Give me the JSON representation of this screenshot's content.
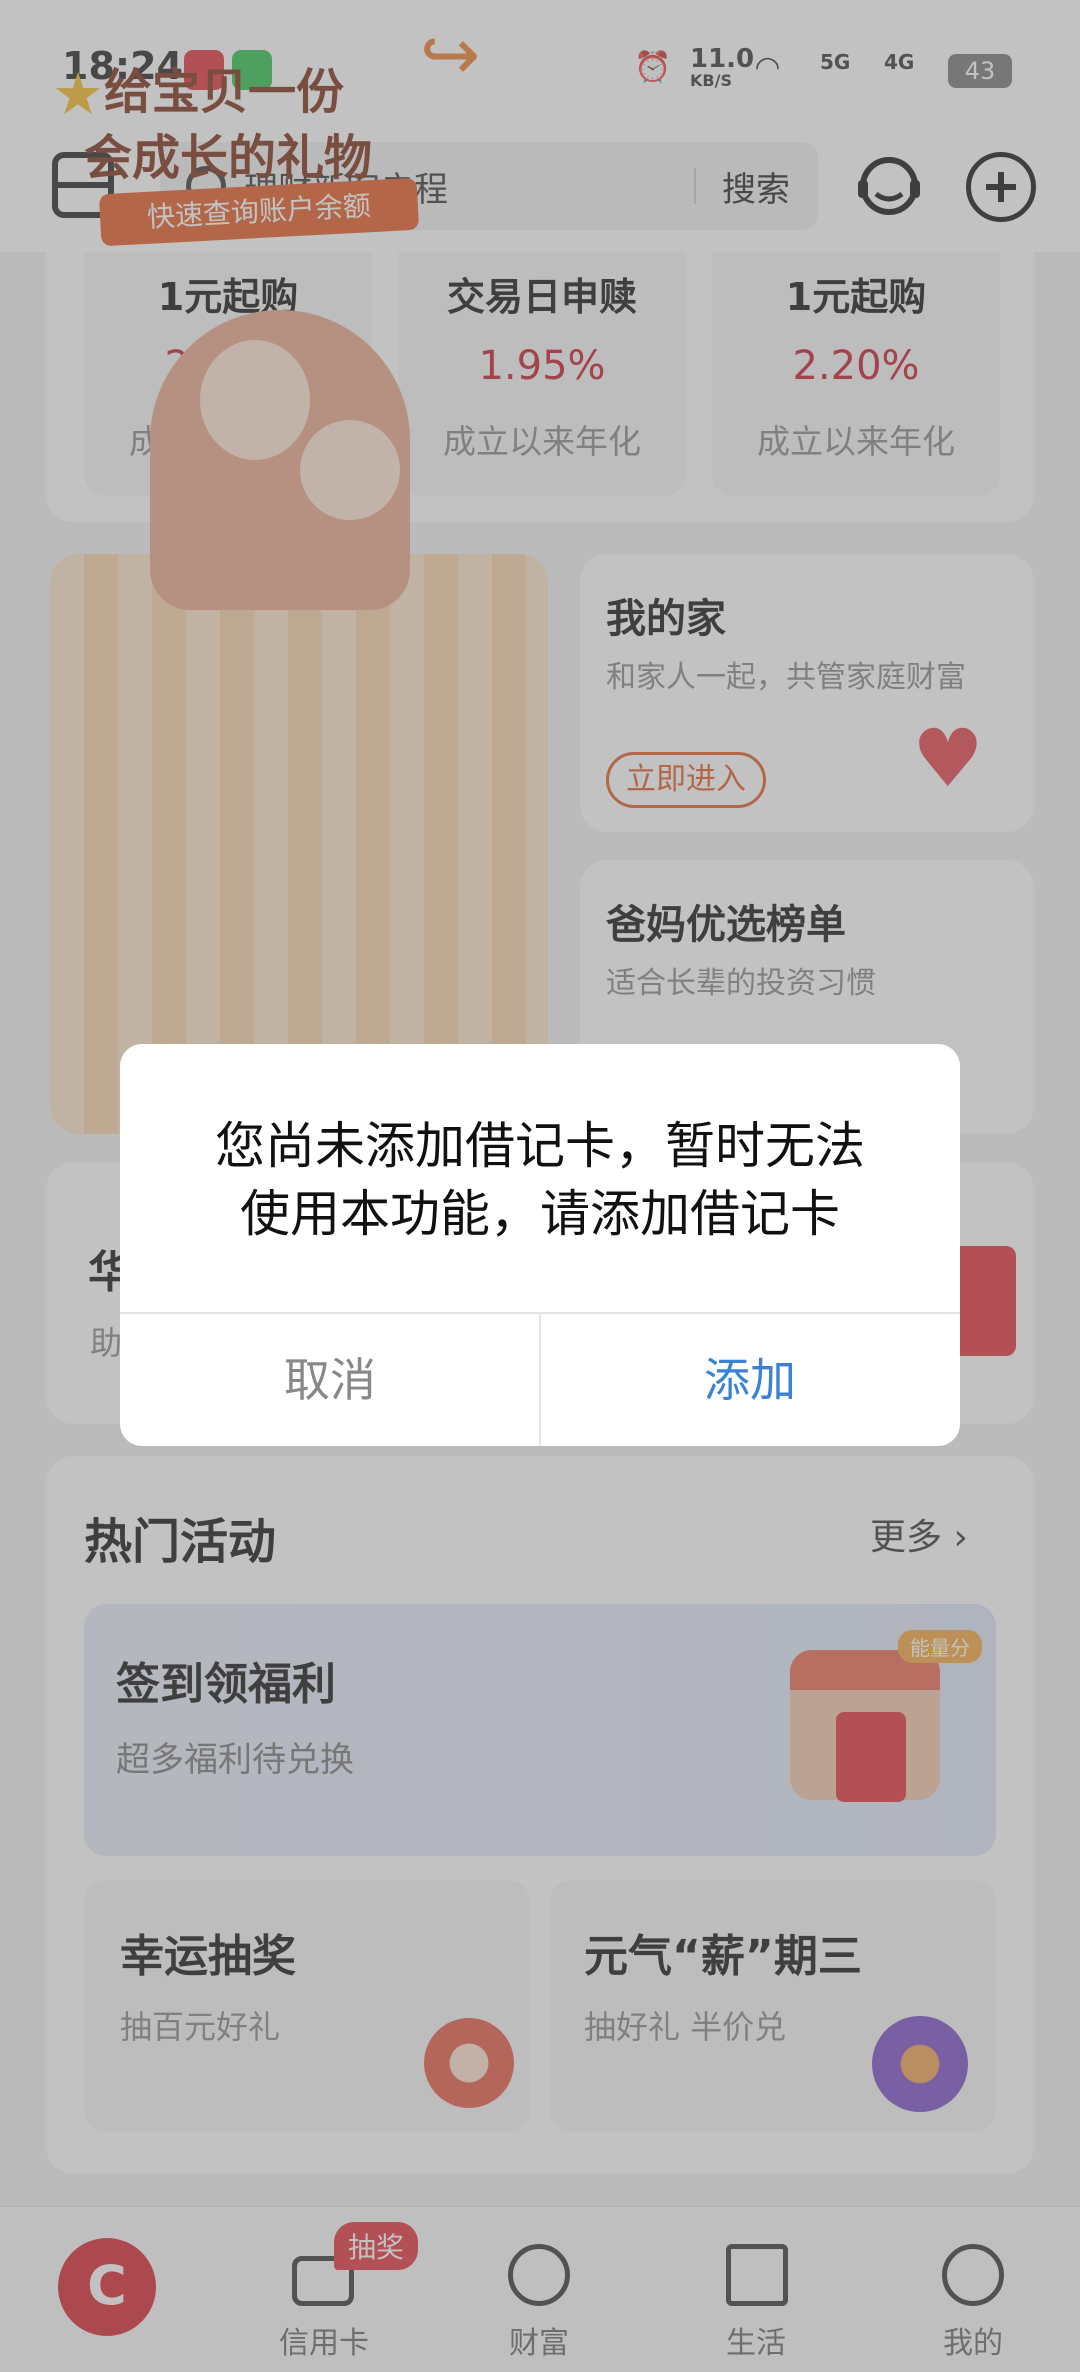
{
  "status_bar": {
    "time": "18:24",
    "net_speed": "11.0",
    "net_unit": "KB/S",
    "sig1": "5G",
    "sig2": "4G",
    "battery": "43"
  },
  "header": {
    "search_placeholder": "理财新客启程",
    "search_button": "搜索"
  },
  "products": [
    {
      "title": "1元起购",
      "rate": "2.14%",
      "sub": "成立以来年化"
    },
    {
      "title": "交易日申赎",
      "rate": "1.95%",
      "sub": "成立以来年化"
    },
    {
      "title": "1元起购",
      "rate": "2.20%",
      "sub": "成立以来年化"
    }
  ],
  "banner": {
    "line1": "给宝贝一份",
    "line2": "会成长的礼物",
    "pill": "快速查询账户余额"
  },
  "home_card": {
    "title": "我的家",
    "sub": "和家人一起，共管家庭财富",
    "button": "立即进入"
  },
  "parents_card": {
    "title": "爸妈优选榜单",
    "sub": "适合长辈的投资习惯"
  },
  "huaxia_card": {
    "title": "华",
    "sub": "助"
  },
  "hot": {
    "title": "热门活动",
    "more": "更多",
    "sign": {
      "title": "签到领福利",
      "sub": "超多福利待兑换",
      "energy": "能量分"
    },
    "lucky": {
      "title": "幸运抽奖",
      "sub": "抽百元好礼"
    },
    "wed": {
      "title": "元气“薪”期三",
      "sub": "抽好礼 半价兑"
    }
  },
  "nav": {
    "items": [
      {
        "label": "信用卡"
      },
      {
        "label": "财富"
      },
      {
        "label": "生活"
      },
      {
        "label": "我的"
      }
    ],
    "badge": "抽奖"
  },
  "dialog": {
    "message_line1": "您尚未添加借记卡，暂时无法",
    "message_line2": "使用本功能，请添加借记卡",
    "cancel": "取消",
    "add": "添加"
  },
  "colors": {
    "brand_red": "#d7242f",
    "rate_red": "#c71a2a",
    "link_blue": "#3b82d6",
    "accent_orange": "#e45a22"
  }
}
